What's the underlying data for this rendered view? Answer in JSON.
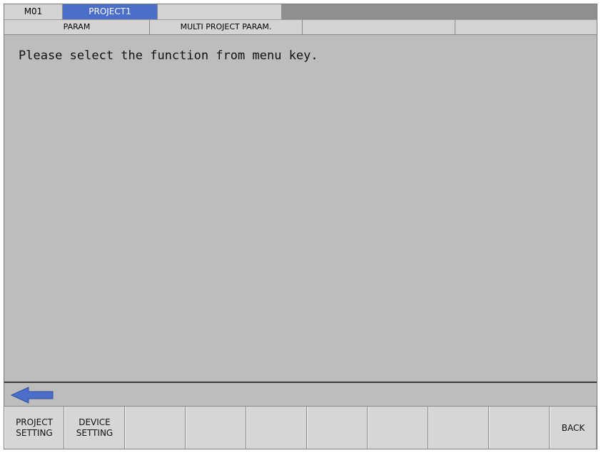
{
  "tabs": {
    "machine": "M01",
    "project": "PROJECT1",
    "blank": ""
  },
  "breadcrumb": [
    "PARAM",
    "MULTI PROJECT PARAM.",
    "",
    ""
  ],
  "message": "Please select the function from menu key.",
  "icons": {
    "back_arrow": "left-arrow-icon"
  },
  "colors": {
    "active_tab": "#4a6ec9",
    "arrow": "#4a6ec9"
  },
  "menu_keys": [
    {
      "label": "PROJECT\nSETTING"
    },
    {
      "label": "DEVICE\nSETTING"
    },
    {
      "label": ""
    },
    {
      "label": ""
    },
    {
      "label": ""
    },
    {
      "label": ""
    },
    {
      "label": ""
    },
    {
      "label": ""
    },
    {
      "label": ""
    },
    {
      "label": "BACK"
    }
  ]
}
